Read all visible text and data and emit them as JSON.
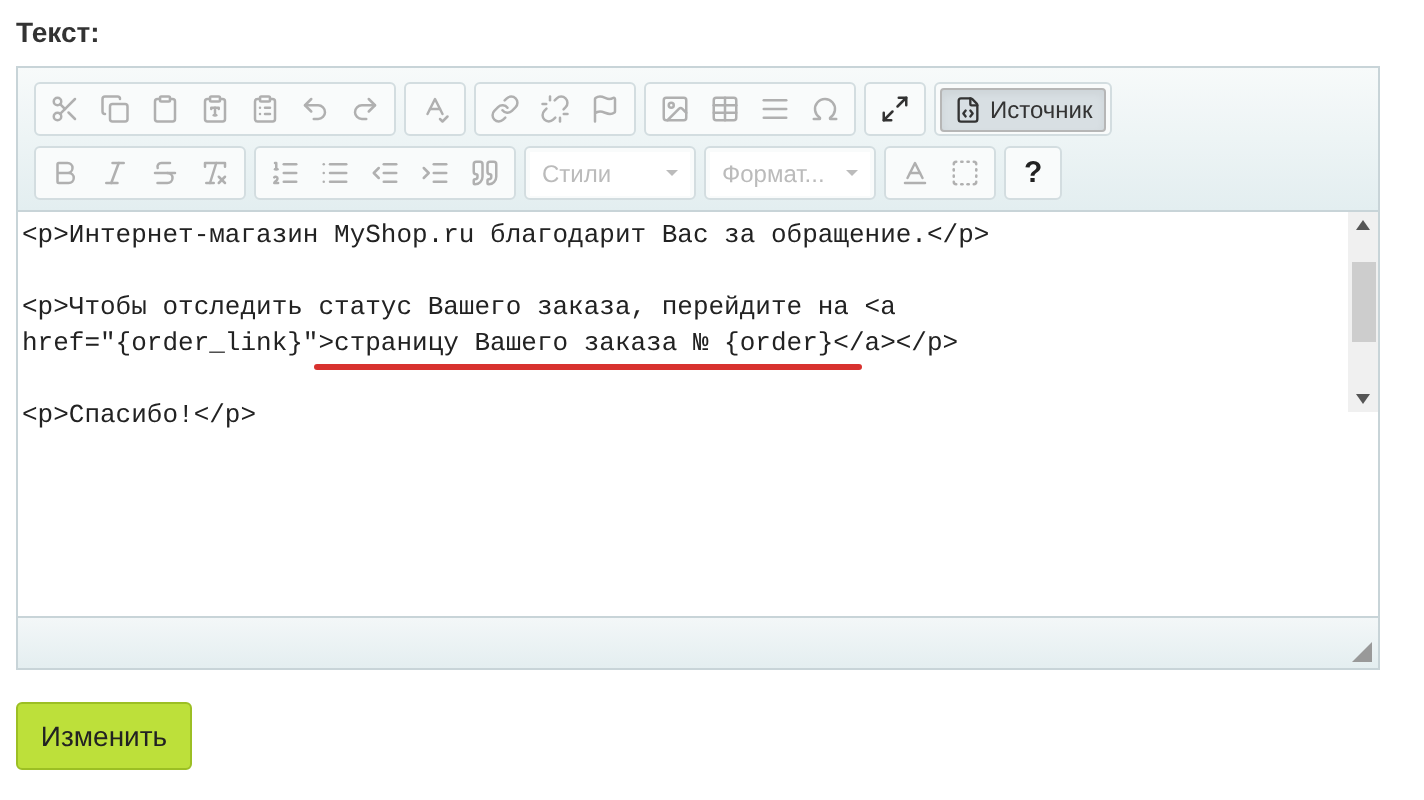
{
  "field_label": "Текст:",
  "toolbar": {
    "rows": [
      [
        [
          {
            "kind": "icon",
            "disabled": true
          },
          {
            "kind": "icon",
            "disabled": true
          },
          {
            "kind": "icon",
            "disabled": true
          },
          {
            "kind": "icon",
            "disabled": true
          },
          {
            "kind": "icon",
            "disabled": true
          },
          {
            "kind": "icon",
            "disabled": true
          },
          {
            "kind": "icon",
            "disabled": true
          }
        ],
        [
          {
            "kind": "icon",
            "disabled": true
          }
        ],
        [
          {
            "kind": "icon",
            "disabled": true
          },
          {
            "kind": "icon",
            "disabled": true
          },
          {
            "kind": "icon",
            "disabled": true
          }
        ],
        [
          {
            "kind": "icon",
            "disabled": true
          },
          {
            "kind": "icon",
            "disabled": true
          },
          {
            "kind": "icon",
            "disabled": true
          },
          {
            "kind": "icon",
            "disabled": true
          }
        ],
        [
          {
            "kind": "icon",
            "disabled": false
          }
        ],
        [
          {
            "kind": "source",
            "label": "Источник",
            "selected": true
          }
        ]
      ],
      [
        [
          {
            "kind": "icon",
            "disabled": true
          },
          {
            "kind": "icon",
            "disabled": true
          },
          {
            "kind": "icon",
            "disabled": true
          },
          {
            "kind": "icon",
            "disabled": true
          }
        ],
        [
          {
            "kind": "icon",
            "disabled": true
          },
          {
            "kind": "icon",
            "disabled": true
          },
          {
            "kind": "icon",
            "disabled": true
          },
          {
            "kind": "icon",
            "disabled": true
          },
          {
            "kind": "icon",
            "disabled": true
          }
        ],
        [
          {
            "kind": "dropdown",
            "label": "Стили",
            "disabled": true
          }
        ],
        [
          {
            "kind": "dropdown",
            "label": "Формат...",
            "disabled": true
          }
        ],
        [
          {
            "kind": "icon",
            "disabled": true
          },
          {
            "kind": "icon",
            "disabled": true
          }
        ],
        [
          {
            "kind": "help",
            "label": "?",
            "disabled": false
          }
        ]
      ]
    ]
  },
  "source_paragraphs": [
    [
      "<p>Интернет-магазин MyShop.ru благодарит Вас за обращение.</p>"
    ],
    [
      "<p>Чтобы отследить статус Вашего заказа, перейдите на <a",
      "href=\"{order_link}\">страницу Вашего заказа № {order}</a></p>"
    ],
    [
      "<p>Спасибо!</p>"
    ]
  ],
  "submit_button": "Изменить"
}
